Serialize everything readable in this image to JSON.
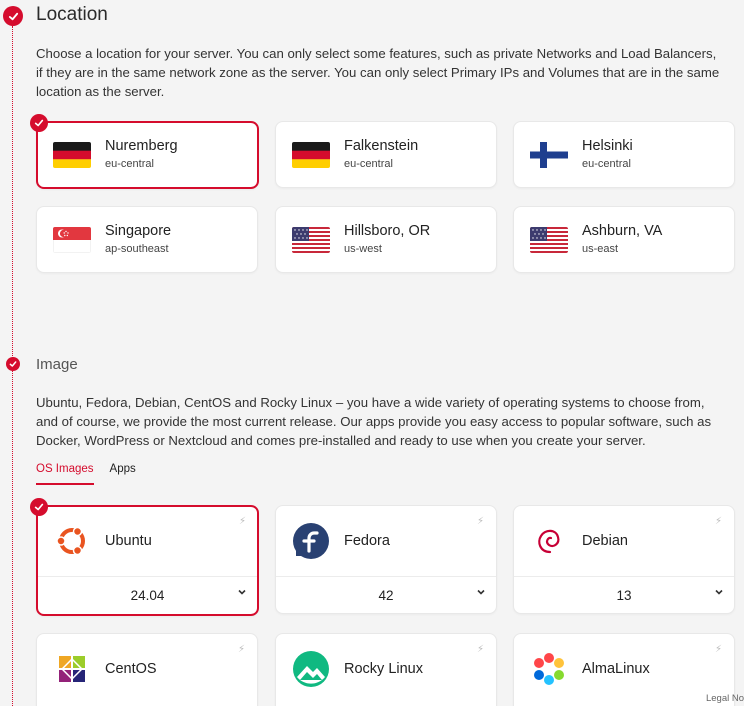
{
  "location": {
    "title": "Location",
    "description": "Choose a location for your server. You can only select some features, such as private Networks and Load Balancers, if they are in the same network zone as the server. You can only select Primary IPs and Volumes that are in the same location as the server.",
    "options": [
      {
        "name": "Nuremberg",
        "zone": "eu-central",
        "flag": "germany-flag",
        "selected": true
      },
      {
        "name": "Falkenstein",
        "zone": "eu-central",
        "flag": "germany-flag",
        "selected": false
      },
      {
        "name": "Helsinki",
        "zone": "eu-central",
        "flag": "finland-flag",
        "selected": false
      },
      {
        "name": "Singapore",
        "zone": "ap-southeast",
        "flag": "singapore-flag",
        "selected": false
      },
      {
        "name": "Hillsboro, OR",
        "zone": "us-west",
        "flag": "usa-flag",
        "selected": false
      },
      {
        "name": "Ashburn, VA",
        "zone": "us-east",
        "flag": "usa-flag",
        "selected": false
      }
    ]
  },
  "image": {
    "title": "Image",
    "description": "Ubuntu, Fedora, Debian, CentOS and Rocky Linux – you have a wide variety of operating systems to choose from, and of course, we provide the most current release. Our apps provide you easy access to popular software, such as Docker, WordPress or Nextcloud and comes pre-installed and ready to use when you create your server.",
    "tabs": [
      {
        "label": "OS Images",
        "active": true
      },
      {
        "label": "Apps",
        "active": false
      }
    ],
    "os": [
      {
        "name": "Ubuntu",
        "version": "24.04",
        "icon": "ubuntu-logo-icon",
        "selected": true
      },
      {
        "name": "Fedora",
        "version": "42",
        "icon": "fedora-logo-icon",
        "selected": false
      },
      {
        "name": "Debian",
        "version": "13",
        "icon": "debian-logo-icon",
        "selected": false
      },
      {
        "name": "CentOS",
        "version": "",
        "icon": "centos-logo-icon",
        "selected": false
      },
      {
        "name": "Rocky Linux",
        "version": "",
        "icon": "rocky-linux-logo-icon",
        "selected": false
      },
      {
        "name": "AlmaLinux",
        "version": "",
        "icon": "almalinux-logo-icon",
        "selected": false
      }
    ],
    "bolt_icon": "lightning-bolt-icon",
    "chevron_icon": "chevron-down-icon"
  },
  "footer": {
    "legal": "Legal No"
  },
  "colors": {
    "accent": "#d50c2d",
    "background": "#f4f4f4"
  }
}
